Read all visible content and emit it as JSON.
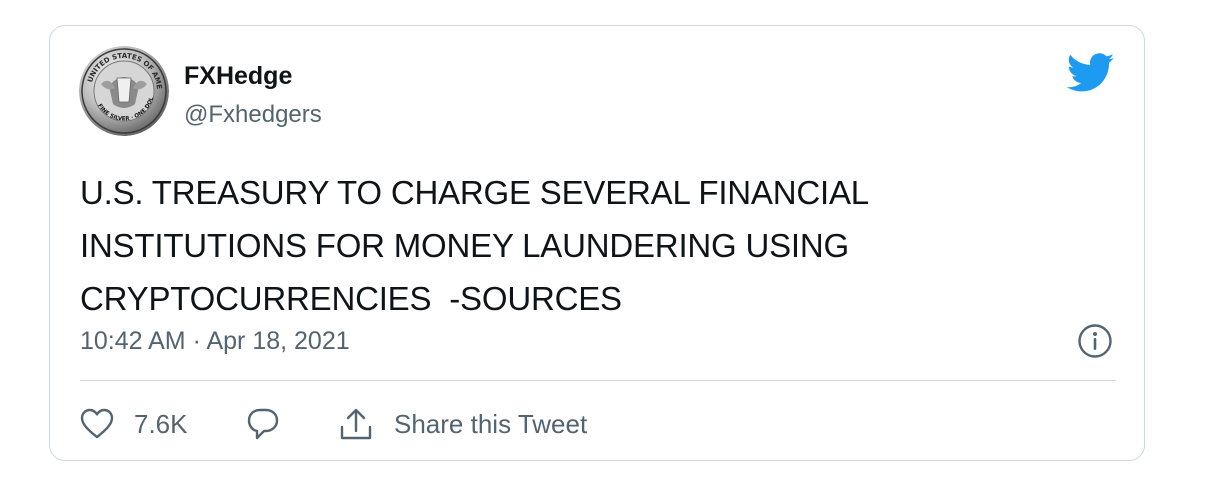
{
  "tweet": {
    "display_name": "FXHedge",
    "handle": "@Fxhedgers",
    "text": "U.S. TREASURY TO CHARGE SEVERAL FINANCIAL\nINSTITUTIONS FOR MONEY LAUNDERING USING\nCRYPTOCURRENCIES  -SOURCES",
    "timestamp": "10:42 AM · Apr 18, 2021"
  },
  "actions": {
    "like_count": "7.6K",
    "share_label": "Share this Tweet"
  },
  "avatar": {
    "seal_text": "UNITED STATES OF AMERICA",
    "seal_bottom_text": "FINE SILVER · ONE DOLLAR"
  },
  "icons": {
    "brand": "twitter-bird-icon",
    "info": "info-icon",
    "like": "heart-icon",
    "reply": "reply-bubble-icon",
    "share": "share-upload-icon"
  },
  "colors": {
    "brand": "#1d9bf0",
    "text_primary": "#0f1419",
    "text_secondary": "#536471",
    "border": "#cfd9de"
  }
}
